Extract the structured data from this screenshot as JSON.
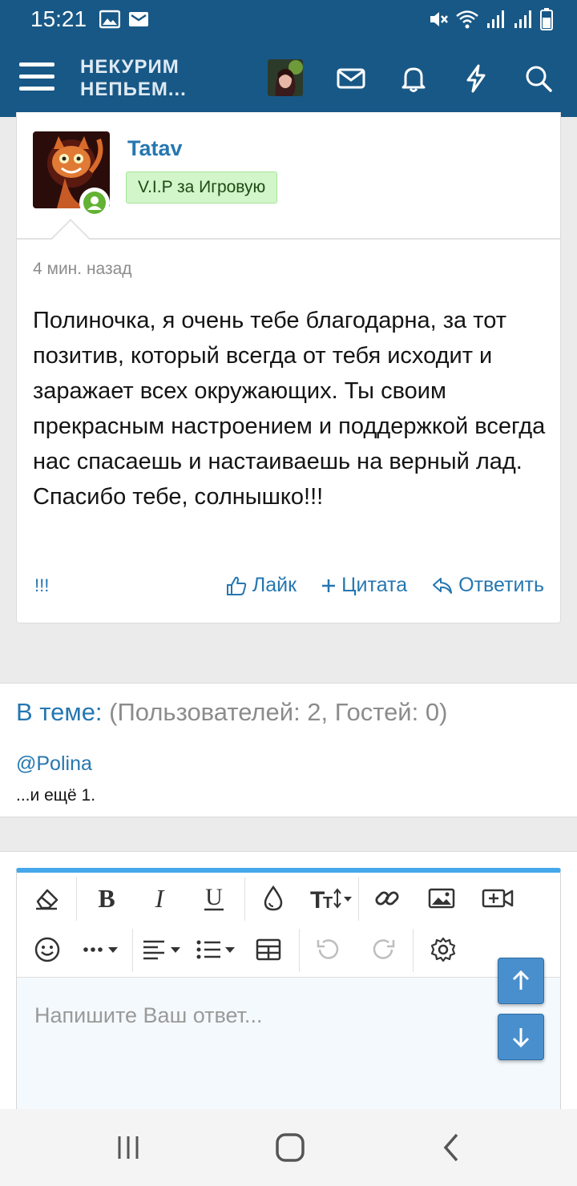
{
  "status_bar": {
    "time": "15:21"
  },
  "header": {
    "logo_line1": "НЕКУРИМ",
    "logo_line2": "НЕПЬЕМ...",
    "icons": [
      "menu-icon",
      "avatar",
      "mail-icon",
      "bell-icon",
      "lightning-icon",
      "search-icon"
    ]
  },
  "post": {
    "username": "Tatav",
    "user_title": "V.I.P за Игровую",
    "time": "4 мин. назад",
    "body": "Полиночка, я очень тебе благодарна, за тот позитив, который всегда от тебя исходит и заражает всех окружающих. Ты своим прекрасным настроением и поддержкой всегда нас спасаешь и настаиваешь на верный лад. Спасибо тебе, солнышко!!!",
    "marks": "!!!",
    "actions": {
      "like": "Лайк",
      "quote": "Цитата",
      "reply": "Ответить"
    }
  },
  "members": {
    "title_label": "В теме:",
    "title_counts": "(Пользователей: 2, Гостей: 0)",
    "user": "@Polina",
    "more": "...и ещё 1."
  },
  "editor": {
    "placeholder": "Напишите Ваш ответ..."
  },
  "colors": {
    "header_bg": "#185886",
    "link": "#2577b1",
    "badge_bg": "#d2f5c9",
    "editor_accent": "#47a7eb",
    "scroll_button": "#4a8fcd"
  }
}
